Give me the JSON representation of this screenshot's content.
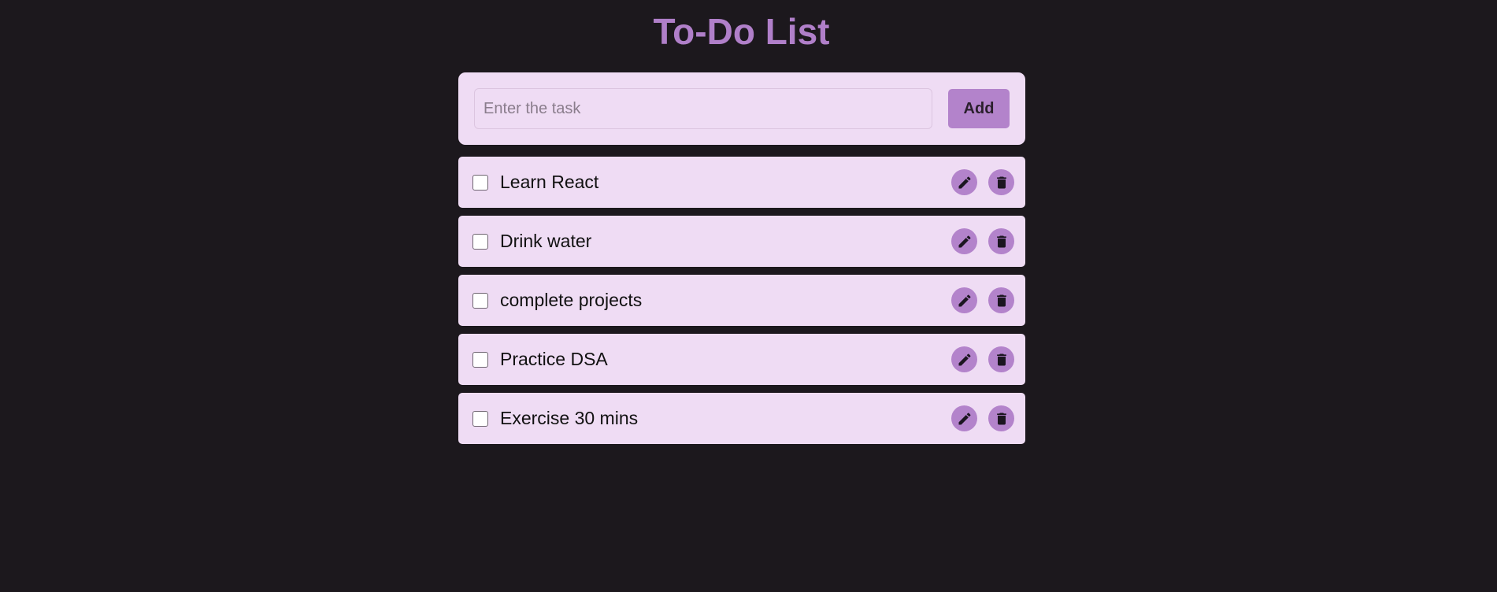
{
  "header": {
    "title": "To-Do List"
  },
  "new_task": {
    "value": "",
    "placeholder": "Enter the task",
    "add_label": "Add"
  },
  "tasks": [
    {
      "text": "Learn React",
      "checked": false
    },
    {
      "text": "Drink water",
      "checked": false
    },
    {
      "text": "complete projects",
      "checked": false
    },
    {
      "text": "Practice DSA",
      "checked": false
    },
    {
      "text": "Exercise 30 mins",
      "checked": false
    }
  ],
  "icons": {
    "edit": "pencil-icon",
    "delete": "trash-icon"
  },
  "colors": {
    "background": "#1c181d",
    "title": "#b07fc9",
    "card": "#efdcf4",
    "accent": "#b383cb",
    "icon_glyph": "#1b1520"
  }
}
